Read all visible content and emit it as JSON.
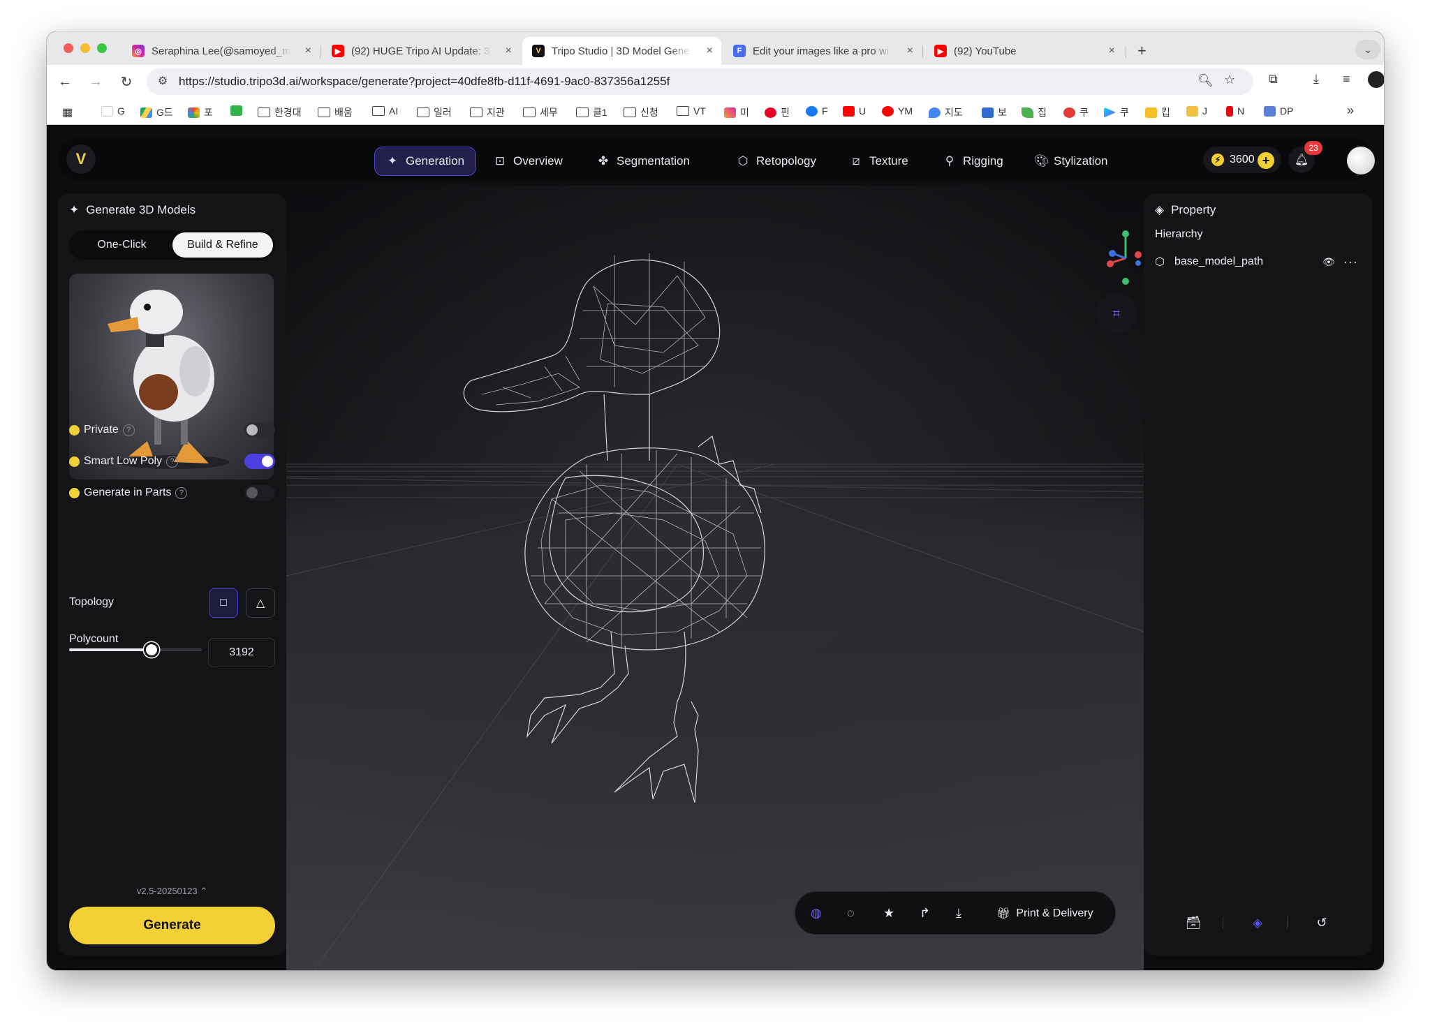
{
  "browser": {
    "tabs": [
      {
        "title": "Seraphina Lee(@samoyed_m",
        "favicon": "instagram-icon",
        "color": "#d6249f"
      },
      {
        "title": "(92) HUGE Tripo AI Update: 3",
        "favicon": "youtube-icon",
        "color": "#ff0000"
      },
      {
        "title": "Tripo Studio | 3D Model Gene",
        "favicon": "tripo-icon",
        "color": "#111111"
      },
      {
        "title": "Edit your images like a pro wi",
        "favicon": "form-icon",
        "color": "#4285f4"
      },
      {
        "title": "(92) YouTube",
        "favicon": "youtube-icon",
        "color": "#ff0000"
      }
    ],
    "close_glyph": "×",
    "new_tab_glyph": "+",
    "url": "https://studio.tripo3d.ai/workspace/generate?project=40dfe8fb-d11f-4691-9ac0-837356a1255f",
    "bookmarks": [
      "G",
      "G드",
      "포",
      "",
      "한경대",
      "배움",
      "AI",
      "일러",
      "지관",
      "세무",
      "클1",
      "신청",
      "VT",
      "미",
      "핀",
      "F",
      "U",
      "YM",
      "지도",
      "보",
      "집",
      "쿠",
      "쿠",
      "킵",
      "J",
      "N",
      "DP"
    ],
    "bookmarks_more": "»"
  },
  "app": {
    "nav": [
      {
        "label": "Generation",
        "icon": "sparkle-icon",
        "active": true
      },
      {
        "label": "Overview",
        "icon": "overview-icon",
        "active": false
      },
      {
        "label": "Segmentation",
        "icon": "segmentation-icon",
        "active": false
      },
      {
        "label": "Retopology",
        "icon": "retopology-icon",
        "active": false
      },
      {
        "label": "Texture",
        "icon": "texture-icon",
        "active": false
      },
      {
        "label": "Rigging",
        "icon": "rigging-icon",
        "active": false
      },
      {
        "label": "Stylization",
        "icon": "palette-icon",
        "active": false
      }
    ],
    "credits": "3600",
    "notification_count": "23",
    "accent_color": "#4b3fe0",
    "brand_yellow": "#f3cf36"
  },
  "left_panel": {
    "title": "Generate 3D Models",
    "modes": [
      "One-Click",
      "Build & Refine"
    ],
    "selected_mode": "Build & Refine",
    "options": [
      {
        "label": "Private",
        "on": false
      },
      {
        "label": "Smart Low Poly",
        "on": true
      },
      {
        "label": "Generate in Parts",
        "on": false
      }
    ],
    "help_glyph": "?",
    "topology_label": "Topology",
    "topology_selected": "quad",
    "polycount_label": "Polycount",
    "polycount_value": "3192",
    "polycount_fraction": 0.62,
    "version": "v2.5-20250123",
    "generate_label": "Generate"
  },
  "viewport": {
    "bottom_toolbar": [
      "wireframe-icon",
      "circle-icon",
      "star-icon",
      "share-icon",
      "download-icon"
    ],
    "print_label": "Print & Delivery"
  },
  "right_panel": {
    "title": "Property",
    "hierarchy_label": "Hierarchy",
    "item_name": "base_model_path"
  }
}
